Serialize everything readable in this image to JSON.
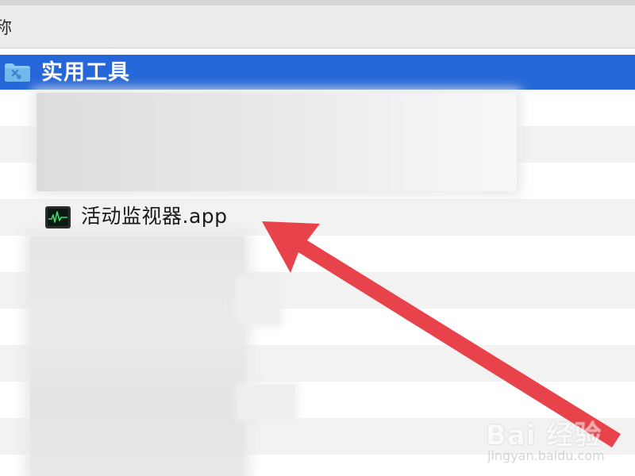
{
  "header": {
    "column_label": "称"
  },
  "selected_folder": {
    "icon": "folder-tools-icon",
    "label": "实用工具"
  },
  "app_item": {
    "icon": "activity-monitor-icon",
    "label": "活动监视器.app"
  },
  "annotation": {
    "type": "arrow",
    "color": "#e8434a"
  },
  "watermark": {
    "main": "Bai 经验",
    "sub": "jingyan.baidu.com"
  },
  "colors": {
    "selection": "#2567d8",
    "header_bg": "#ececec",
    "row_alt": "#f2f2f2"
  }
}
